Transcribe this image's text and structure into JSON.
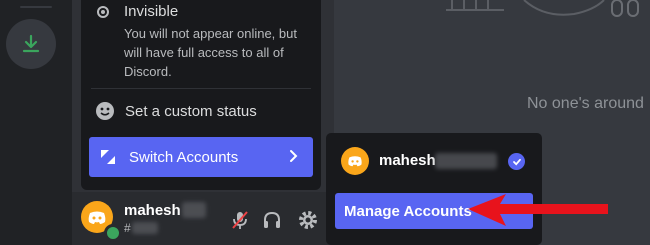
{
  "status_menu": {
    "invisible_title": "Invisible",
    "invisible_desc": "You will not appear online, but will have full access to all of Discord.",
    "custom_status_label": "Set a custom status",
    "switch_accounts_label": "Switch Accounts"
  },
  "user_panel": {
    "username": "mahesh",
    "tag": "#"
  },
  "account_switcher": {
    "accounts": [
      {
        "name": "mahesh",
        "selected": true
      }
    ],
    "manage_label": "Manage Accounts"
  },
  "main": {
    "empty_text": "No one's around"
  },
  "colors": {
    "accent": "#5865f2",
    "avatar": "#faa61a",
    "online": "#3ba55d",
    "muted_red": "#ed4245",
    "arrow_red": "#e8131c"
  }
}
